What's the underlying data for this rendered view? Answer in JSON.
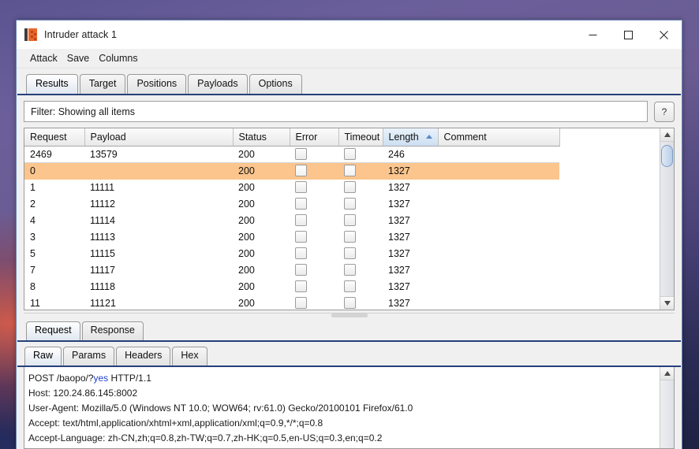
{
  "window": {
    "title": "Intruder attack 1",
    "icon": "burp-suite-icon",
    "controls": {
      "minimize": "minimize-icon",
      "maximize": "maximize-icon",
      "close": "close-icon"
    }
  },
  "menubar": {
    "items": [
      "Attack",
      "Save",
      "Columns"
    ]
  },
  "main_tabs": [
    {
      "label": "Results",
      "active": true
    },
    {
      "label": "Target",
      "active": false
    },
    {
      "label": "Positions",
      "active": false
    },
    {
      "label": "Payloads",
      "active": false
    },
    {
      "label": "Options",
      "active": false
    }
  ],
  "filter": {
    "text": "Filter: Showing all items",
    "help_label": "?"
  },
  "results_table": {
    "columns": [
      {
        "label": "Request",
        "sorted": false
      },
      {
        "label": "Payload",
        "sorted": false
      },
      {
        "label": "Status",
        "sorted": false
      },
      {
        "label": "Error",
        "sorted": false
      },
      {
        "label": "Timeout",
        "sorted": false
      },
      {
        "label": "Length",
        "sorted": true,
        "sort_direction": "ascending"
      },
      {
        "label": "Comment",
        "sorted": false
      }
    ],
    "rows": [
      {
        "request": "2469",
        "payload": "13579",
        "status": "200",
        "error": false,
        "timeout": false,
        "length": "246",
        "comment": "",
        "selected": false
      },
      {
        "request": "0",
        "payload": "",
        "status": "200",
        "error": false,
        "timeout": false,
        "length": "1327",
        "comment": "",
        "selected": true
      },
      {
        "request": "1",
        "payload": "11111",
        "status": "200",
        "error": false,
        "timeout": false,
        "length": "1327",
        "comment": "",
        "selected": false
      },
      {
        "request": "2",
        "payload": "11112",
        "status": "200",
        "error": false,
        "timeout": false,
        "length": "1327",
        "comment": "",
        "selected": false
      },
      {
        "request": "4",
        "payload": "11114",
        "status": "200",
        "error": false,
        "timeout": false,
        "length": "1327",
        "comment": "",
        "selected": false
      },
      {
        "request": "3",
        "payload": "11113",
        "status": "200",
        "error": false,
        "timeout": false,
        "length": "1327",
        "comment": "",
        "selected": false
      },
      {
        "request": "5",
        "payload": "11115",
        "status": "200",
        "error": false,
        "timeout": false,
        "length": "1327",
        "comment": "",
        "selected": false
      },
      {
        "request": "7",
        "payload": "11117",
        "status": "200",
        "error": false,
        "timeout": false,
        "length": "1327",
        "comment": "",
        "selected": false
      },
      {
        "request": "8",
        "payload": "11118",
        "status": "200",
        "error": false,
        "timeout": false,
        "length": "1327",
        "comment": "",
        "selected": false
      },
      {
        "request": "11",
        "payload": "11121",
        "status": "200",
        "error": false,
        "timeout": false,
        "length": "1327",
        "comment": "",
        "selected": false
      }
    ]
  },
  "message_tabs": [
    {
      "label": "Request",
      "active": true
    },
    {
      "label": "Response",
      "active": false
    }
  ],
  "view_tabs": [
    {
      "label": "Raw",
      "active": true
    },
    {
      "label": "Params",
      "active": false
    },
    {
      "label": "Headers",
      "active": false
    },
    {
      "label": "Hex",
      "active": false
    }
  ],
  "request_message": {
    "line1_pre": "POST /baopo/?",
    "line1_highlight": "yes",
    "line1_post": " HTTP/1.1",
    "lines": [
      "Host: 120.24.86.145:8002",
      "User-Agent: Mozilla/5.0 (Windows NT 10.0; WOW64; rv:61.0) Gecko/20100101 Firefox/61.0",
      "Accept: text/html,application/xhtml+xml,application/xml;q=0.9,*/*;q=0.8",
      "Accept-Language: zh-CN,zh;q=0.8,zh-TW;q=0.7,zh-HK;q=0.5,en-US;q=0.3,en;q=0.2"
    ]
  },
  "colors": {
    "accent": "#27407a",
    "selection": "#fbc58d",
    "brand_orange": "#e8672a",
    "sort_arrow": "#5a87c4",
    "param_highlight": "#1f3fd0"
  }
}
